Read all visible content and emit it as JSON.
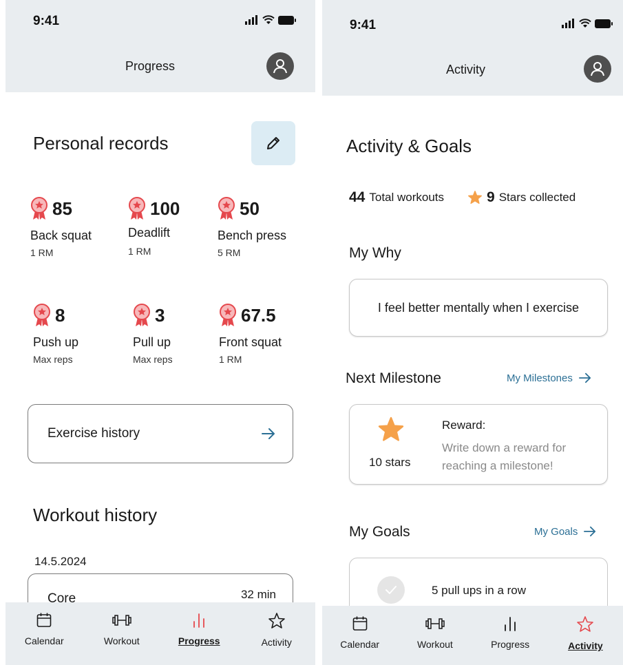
{
  "status_time": "9:41",
  "progress_screen": {
    "title": "Progress",
    "records_title": "Personal records",
    "records": [
      {
        "value": "85",
        "name": "Back squat",
        "unit": "1 RM"
      },
      {
        "value": "100",
        "name": "Deadlift",
        "unit": "1 RM"
      },
      {
        "value": "50",
        "name": "Bench press",
        "unit": "5 RM"
      },
      {
        "value": "8",
        "name": "Push up",
        "unit": "Max reps"
      },
      {
        "value": "3",
        "name": "Pull up",
        "unit": "Max reps"
      },
      {
        "value": "67.5",
        "name": "Front squat",
        "unit": "1 RM"
      }
    ],
    "exercise_history_label": "Exercise history",
    "workout_history_title": "Workout history",
    "history_date": "14.5.2024",
    "workout": {
      "name": "Core",
      "duration": "32 min"
    }
  },
  "activity_screen": {
    "title": "Activity",
    "goals_title": "Activity & Goals",
    "total_workouts_value": "44",
    "total_workouts_label": "Total workouts",
    "stars_value": "9",
    "stars_label": "Stars collected",
    "my_why_title": "My Why",
    "my_why_text": "I feel better mentally when I exercise",
    "next_milestone_title": "Next Milestone",
    "my_milestones_link": "My Milestones",
    "milestone_stars": "10 stars",
    "reward_title": "Reward:",
    "reward_text": "Write down a reward for reaching a milestone!",
    "my_goals_title": "My Goals",
    "my_goals_link": "My Goals",
    "goal_text": "5 pull ups in a row"
  },
  "nav": {
    "calendar": "Calendar",
    "workout": "Workout",
    "progress": "Progress",
    "activity": "Activity"
  },
  "colors": {
    "accent_red": "#e5484d",
    "star_orange": "#f5a14a",
    "link_blue": "#2b6f95",
    "header_bg": "#e9edf0"
  }
}
